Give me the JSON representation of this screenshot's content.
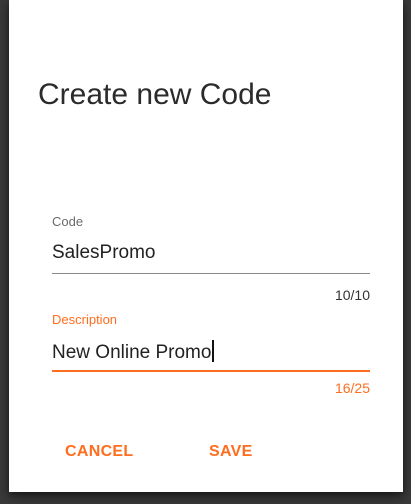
{
  "dialog": {
    "title": "Create new Code"
  },
  "fields": {
    "code": {
      "label": "Code",
      "value": "SalesPromo",
      "counter": "10/10"
    },
    "description": {
      "label": "Description",
      "value": "New Online Promo",
      "counter": "16/25"
    }
  },
  "actions": {
    "cancel_label": "CANCEL",
    "save_label": "SAVE"
  },
  "colors": {
    "accent": "#ff6d1f",
    "label_inactive": "#6b6b6b",
    "underline_inactive": "#8a8a8a",
    "text": "#222222",
    "backdrop": "#3a3a3a"
  }
}
